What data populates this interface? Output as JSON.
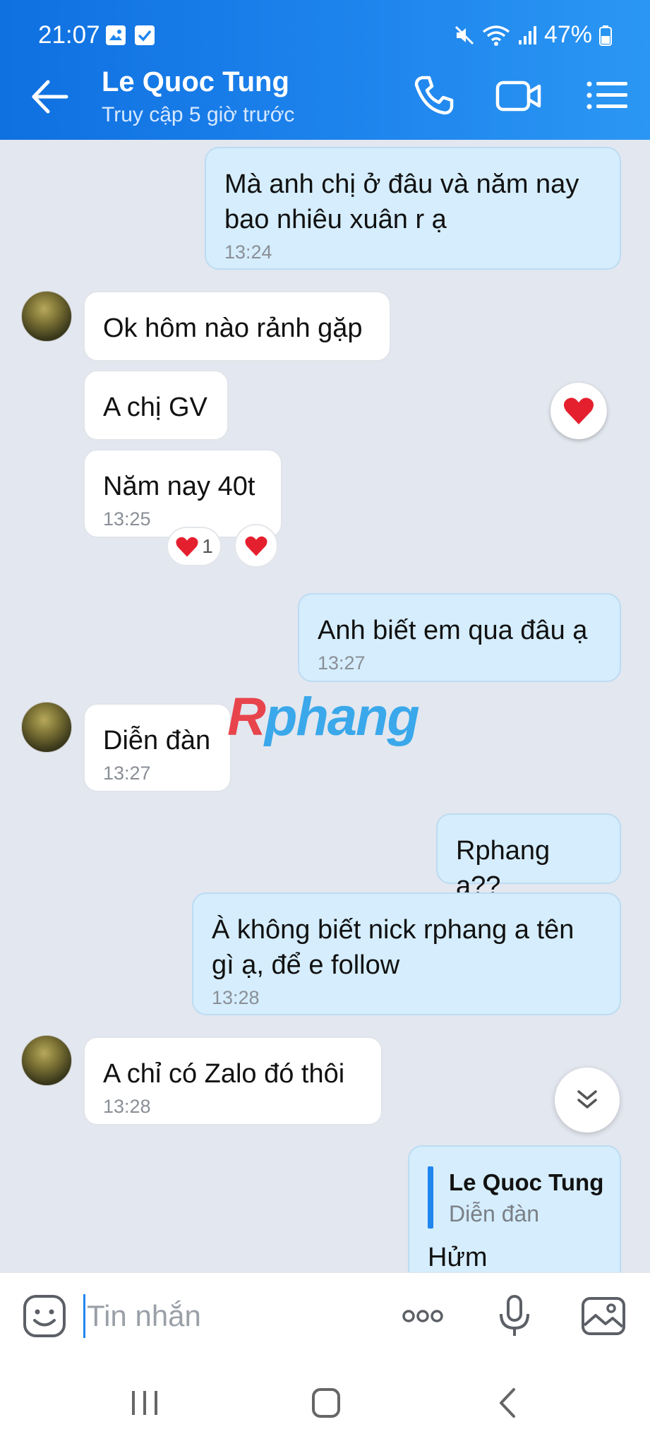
{
  "status_bar": {
    "time": "21:07",
    "battery": "47%"
  },
  "header": {
    "contact_name": "Le Quoc Tung",
    "contact_status": "Truy cập 5 giờ trước"
  },
  "messages": [
    {
      "line1": "Mà anh chị ở đâu và năm nay",
      "line2": "bao nhiêu xuân r ạ",
      "time": "13:24"
    },
    {
      "text": "Ok hôm nào rảnh gặp"
    },
    {
      "text": "A chị GV"
    },
    {
      "text": "Năm nay 40t",
      "time": "13:25",
      "reaction_count": "1"
    },
    {
      "text": "Anh biết em qua đâu ạ",
      "time": "13:27"
    },
    {
      "text": "Diễn đàn",
      "time": "13:27"
    },
    {
      "text": "Rphang ạ??"
    },
    {
      "line1": "À không biết nick rphang a tên",
      "line2": "gì ạ, để e follow",
      "time": "13:28"
    },
    {
      "text": "A chỉ có Zalo đó thôi",
      "time": "13:28"
    },
    {
      "quote_name": "Le Quoc Tung",
      "quote_text": "Diễn đàn",
      "text": "Hửm"
    }
  ],
  "watermark": {
    "first": "R",
    "rest": "phang"
  },
  "input": {
    "placeholder": "Tin nhắn"
  },
  "icons": {
    "accent": "#1f86ee",
    "heart": "#e5202e",
    "header_bg": "#1f86ee"
  }
}
